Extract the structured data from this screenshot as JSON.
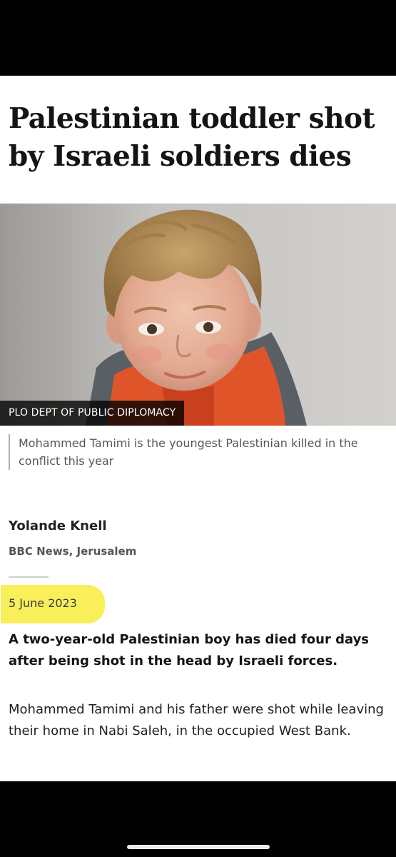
{
  "article": {
    "headline": "Palestinian toddler shot by Israeli soldiers dies",
    "image_credit": "PLO DEPT OF PUBLIC DIPLOMACY",
    "image_caption": "Mohammed Tamimi is the youngest Palestinian killed in the conflict this year",
    "author_name": "Yolande Knell",
    "author_org": "BBC News, Jerusalem",
    "date": "5 June 2023",
    "lead": "A two-year-old Palestinian boy has died four days after being shot in the head by Israeli forces.",
    "body": "Mohammed Tamimi and his father were shot while leaving their home in Nabi Saleh, in the occupied West Bank."
  },
  "colors": {
    "highlight": "#f9ef5a",
    "frame": "#000000"
  }
}
